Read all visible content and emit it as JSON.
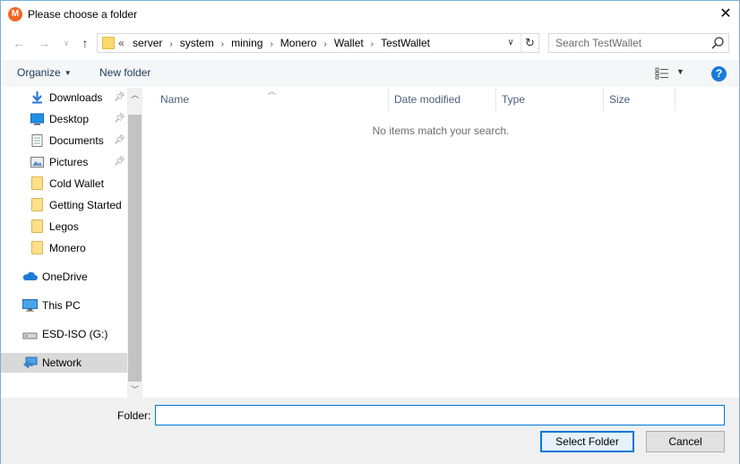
{
  "window": {
    "title": "Please choose a folder",
    "app_icon_letter": "M"
  },
  "nav": {
    "back_icon": "arrow-left-icon",
    "forward_icon": "arrow-right-icon",
    "recent_icon": "chevron-down-icon",
    "up_icon": "arrow-up-icon"
  },
  "address": {
    "overflow": "«",
    "crumbs": [
      "server",
      "system",
      "mining",
      "Monero",
      "Wallet",
      "TestWallet"
    ]
  },
  "search": {
    "placeholder": "Search TestWallet"
  },
  "commands": {
    "organize": "Organize",
    "new_folder": "New folder"
  },
  "sidebar": {
    "items": [
      {
        "label": "Downloads",
        "icon": "download-icon",
        "pinned": true
      },
      {
        "label": "Desktop",
        "icon": "desktop-icon",
        "pinned": true
      },
      {
        "label": "Documents",
        "icon": "documents-icon",
        "pinned": true
      },
      {
        "label": "Pictures",
        "icon": "pictures-icon",
        "pinned": true
      },
      {
        "label": "Cold Wallet",
        "icon": "folder-icon",
        "pinned": false
      },
      {
        "label": "Getting Started",
        "icon": "folder-icon",
        "pinned": false
      },
      {
        "label": "Legos",
        "icon": "folder-icon",
        "pinned": false
      },
      {
        "label": "Monero",
        "icon": "folder-icon",
        "pinned": false
      },
      {
        "label": "OneDrive",
        "icon": "cloud-icon",
        "pinned": false
      },
      {
        "label": "This PC",
        "icon": "computer-icon",
        "pinned": false
      },
      {
        "label": "ESD-ISO (G:)",
        "icon": "drive-icon",
        "pinned": false
      },
      {
        "label": "Network",
        "icon": "network-icon",
        "pinned": false,
        "selected": true
      }
    ]
  },
  "columns": [
    "Name",
    "Date modified",
    "Type",
    "Size"
  ],
  "content": {
    "empty_message": "No items match your search."
  },
  "footer": {
    "folder_label": "Folder:",
    "folder_value": "",
    "select_button": "Select Folder",
    "cancel_button": "Cancel"
  },
  "colors": {
    "accent": "#0078d7",
    "selection": "#d9d9d9",
    "monero_orange": "#f26822",
    "help_blue": "#1c7ad9"
  }
}
